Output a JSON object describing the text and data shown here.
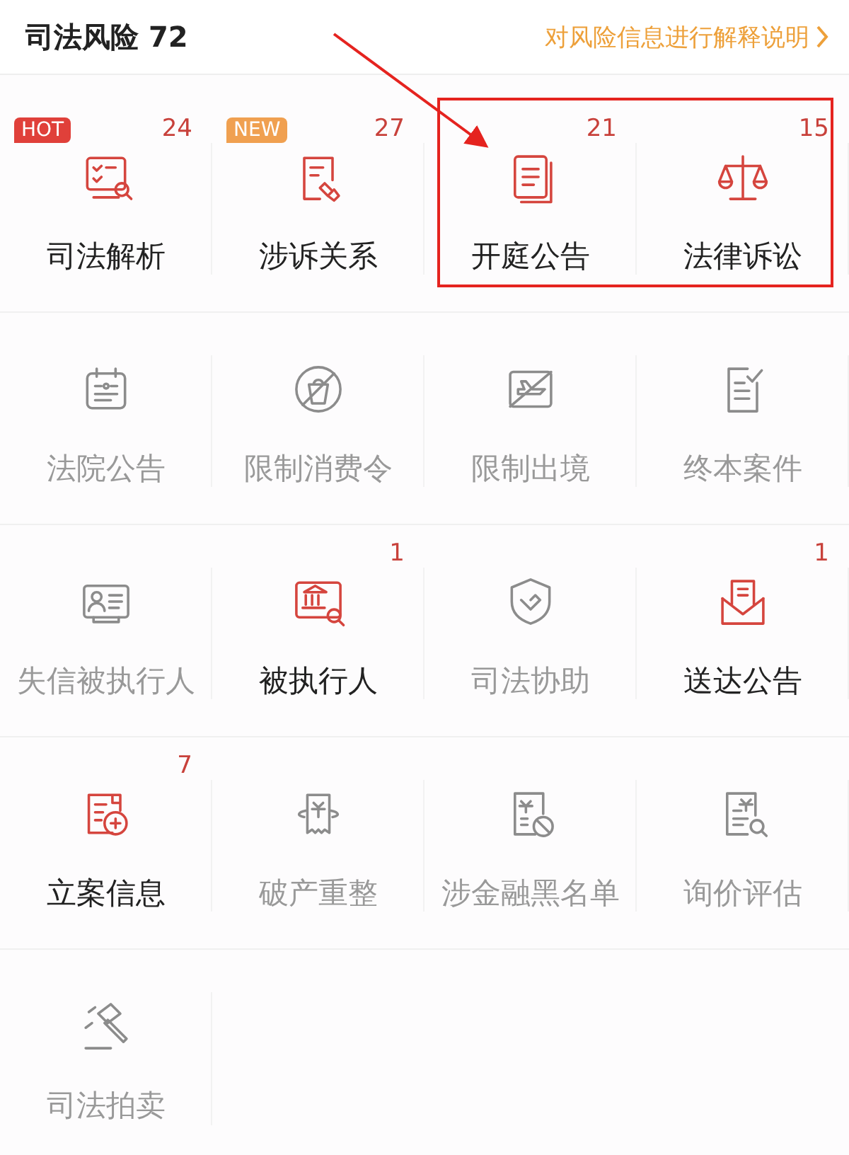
{
  "header": {
    "title": "司法风险",
    "score": "72",
    "link": "对风险信息进行解释说明"
  },
  "items": [
    {
      "label": "司法解析",
      "count": "24",
      "badge": {
        "text": "HOT",
        "kind": "hot"
      },
      "active": true
    },
    {
      "label": "涉诉关系",
      "count": "27",
      "badge": {
        "text": "NEW",
        "kind": "new"
      },
      "active": true
    },
    {
      "label": "开庭公告",
      "count": "21",
      "active": true
    },
    {
      "label": "法律诉讼",
      "count": "15",
      "active": true
    },
    {
      "label": "法院公告",
      "active": false
    },
    {
      "label": "限制消费令",
      "active": false
    },
    {
      "label": "限制出境",
      "active": false
    },
    {
      "label": "终本案件",
      "active": false
    },
    {
      "label": "失信被执行人",
      "active": false
    },
    {
      "label": "被执行人",
      "count": "1",
      "active": true
    },
    {
      "label": "司法协助",
      "active": false
    },
    {
      "label": "送达公告",
      "count": "1",
      "active": true
    },
    {
      "label": "立案信息",
      "count": "7",
      "active": true
    },
    {
      "label": "破产重整",
      "active": false
    },
    {
      "label": "涉金融黑名单",
      "active": false
    },
    {
      "label": "询价评估",
      "active": false
    },
    {
      "label": "司法拍卖",
      "active": false
    }
  ]
}
